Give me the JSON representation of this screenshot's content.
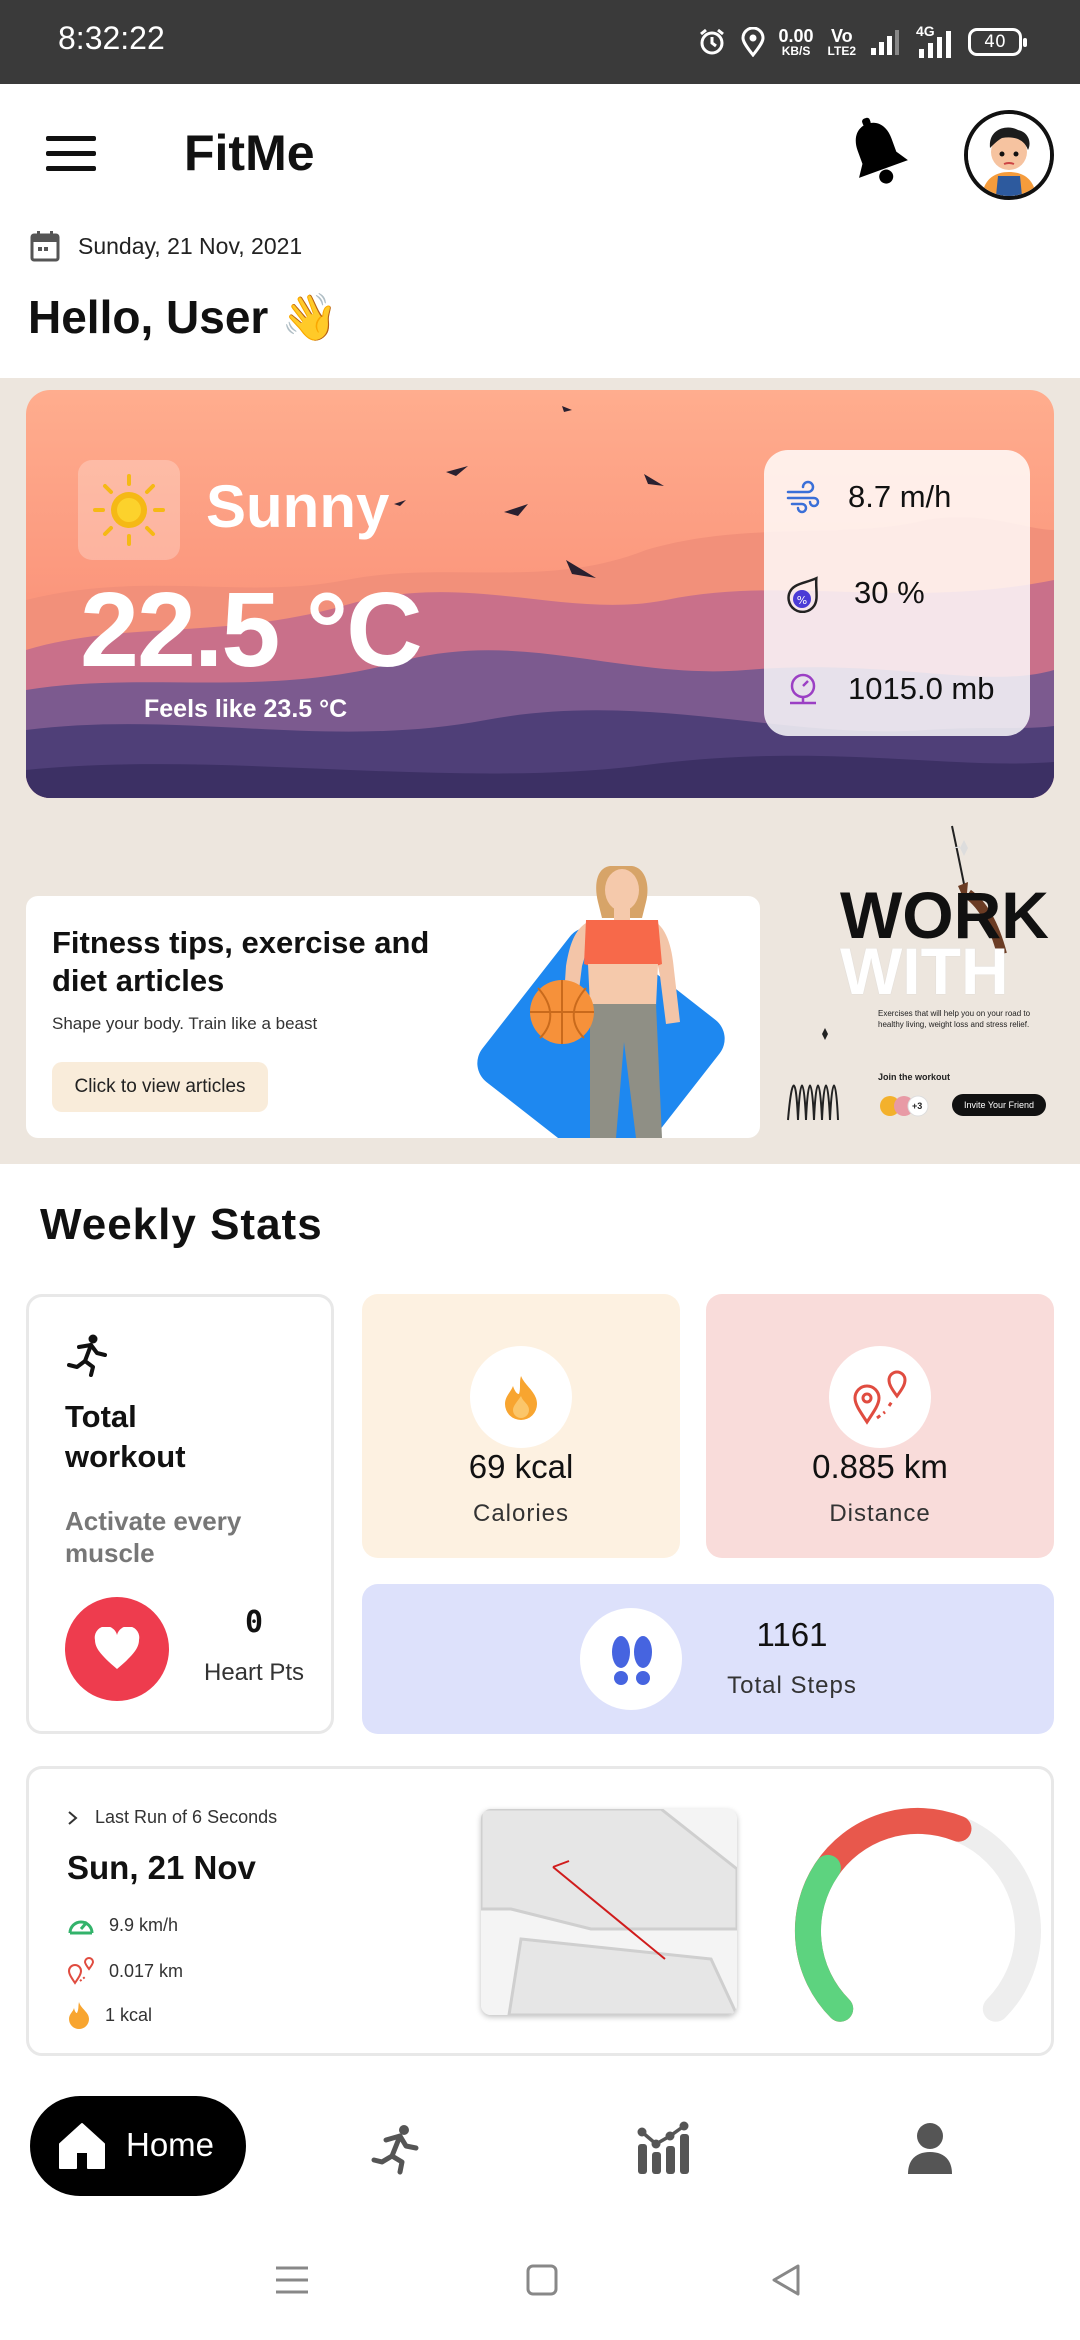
{
  "status_bar": {
    "time": "8:32:22",
    "net_speed_top": "0.00",
    "net_speed_bottom": "KB/S",
    "volte_top": "Vo",
    "volte_bottom": "LTE2",
    "net_type": "4G",
    "battery": "40"
  },
  "header": {
    "title": "FitMe",
    "date": "Sunday, 21 Nov, 2021",
    "greeting": "Hello, User 👋"
  },
  "weather": {
    "condition": "Sunny",
    "temperature": "22.5 °C",
    "feels_like": "Feels like 23.5 °C",
    "wind": "8.7 m/h",
    "humidity": "30 %",
    "pressure": "1015.0 mb"
  },
  "promo": {
    "title": "Fitness tips, exercise and diet articles",
    "subtitle": "Shape your body. Train like a beast",
    "button": "Click to view articles"
  },
  "workout_banner": {
    "line1": "WORK",
    "line2": "WITH",
    "desc": "Exercises that will help you on your road to healthy living, weight loss and stress relief.",
    "join": "Join the workout",
    "extra": "+3",
    "invite": "Invite Your Friend"
  },
  "weekly_stats": {
    "title": "Weekly Stats",
    "total_workout_title": "Total workout",
    "total_workout_sub": "Activate every muscle",
    "heart_value": "0",
    "heart_label": "Heart Pts",
    "calories_value": "69 kcal",
    "calories_label": "Calories",
    "distance_value": "0.885 km",
    "distance_label": "Distance",
    "steps_value": "1161",
    "steps_label": "Total Steps"
  },
  "last_run": {
    "header": "Last Run of 6 Seconds",
    "date": "Sun, 21 Nov",
    "speed": "9.9 km/h",
    "distance": "0.017 km",
    "calories": "1 kcal",
    "gauge_fraction": 0.58,
    "colors": {
      "gauge_red": "#e8584c",
      "gauge_green": "#5dd37f",
      "gauge_track": "#eeeeee"
    }
  },
  "bottom_nav": {
    "home": "Home",
    "icons": [
      "run-icon",
      "stats-icon",
      "profile-icon"
    ]
  },
  "colors": {
    "accent_black": "#000000",
    "heart_red": "#ee3c4e",
    "calories_bg": "#fdf1e1",
    "distance_bg": "#f9dcda",
    "steps_bg": "#dde1fb",
    "band_bg": "#ede6de"
  }
}
